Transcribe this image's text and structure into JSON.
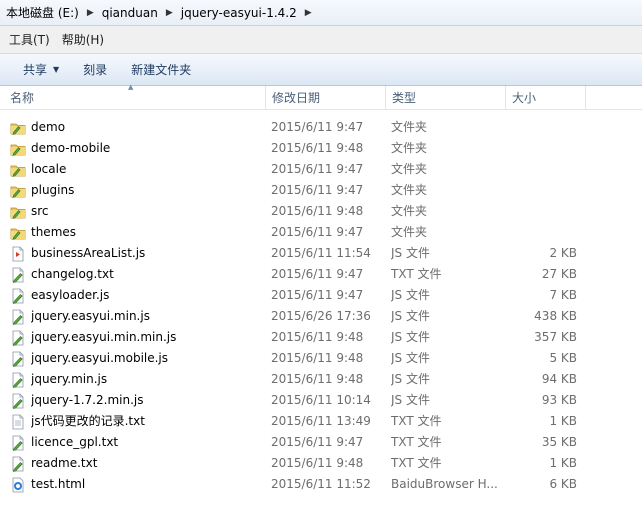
{
  "breadcrumb": [
    "本地磁盘 (E:)",
    "qianduan",
    "jquery-easyui-1.4.2"
  ],
  "menu": [
    "工具(T)",
    "帮助(H)"
  ],
  "toolbar": {
    "share": "共享",
    "burn": "刻录",
    "new_folder": "新建文件夹"
  },
  "columns": {
    "name": "名称",
    "date": "修改日期",
    "type": "类型",
    "size": "大小"
  },
  "files": [
    {
      "icon": "folder-icon",
      "name": "demo",
      "date": "2015/6/11 9:47",
      "type": "文件夹",
      "size": ""
    },
    {
      "icon": "folder-icon",
      "name": "demo-mobile",
      "date": "2015/6/11 9:48",
      "type": "文件夹",
      "size": ""
    },
    {
      "icon": "folder-icon",
      "name": "locale",
      "date": "2015/6/11 9:47",
      "type": "文件夹",
      "size": ""
    },
    {
      "icon": "folder-icon",
      "name": "plugins",
      "date": "2015/6/11 9:47",
      "type": "文件夹",
      "size": ""
    },
    {
      "icon": "folder-icon",
      "name": "src",
      "date": "2015/6/11 9:48",
      "type": "文件夹",
      "size": ""
    },
    {
      "icon": "folder-icon",
      "name": "themes",
      "date": "2015/6/11 9:47",
      "type": "文件夹",
      "size": ""
    },
    {
      "icon": "js-file-red-icon",
      "name": "businessAreaList.js",
      "date": "2015/6/11 11:54",
      "type": "JS 文件",
      "size": "2 KB"
    },
    {
      "icon": "edited-file-icon",
      "name": "changelog.txt",
      "date": "2015/6/11 9:47",
      "type": "TXT 文件",
      "size": "27 KB"
    },
    {
      "icon": "edited-file-icon",
      "name": "easyloader.js",
      "date": "2015/6/11 9:47",
      "type": "JS 文件",
      "size": "7 KB"
    },
    {
      "icon": "edited-file-icon",
      "name": "jquery.easyui.min.js",
      "date": "2015/6/26 17:36",
      "type": "JS 文件",
      "size": "438 KB"
    },
    {
      "icon": "edited-file-icon",
      "name": "jquery.easyui.min.min.js",
      "date": "2015/6/11 9:48",
      "type": "JS 文件",
      "size": "357 KB"
    },
    {
      "icon": "edited-file-icon",
      "name": "jquery.easyui.mobile.js",
      "date": "2015/6/11 9:48",
      "type": "JS 文件",
      "size": "5 KB"
    },
    {
      "icon": "edited-file-icon",
      "name": "jquery.min.js",
      "date": "2015/6/11 9:48",
      "type": "JS 文件",
      "size": "94 KB"
    },
    {
      "icon": "edited-file-icon",
      "name": "jquery-1.7.2.min.js",
      "date": "2015/6/11 10:14",
      "type": "JS 文件",
      "size": "93 KB"
    },
    {
      "icon": "text-file-icon",
      "name": "js代码更改的记录.txt",
      "date": "2015/6/11 13:49",
      "type": "TXT 文件",
      "size": "1 KB"
    },
    {
      "icon": "edited-file-icon",
      "name": "licence_gpl.txt",
      "date": "2015/6/11 9:47",
      "type": "TXT 文件",
      "size": "35 KB"
    },
    {
      "icon": "edited-file-icon",
      "name": "readme.txt",
      "date": "2015/6/11 9:48",
      "type": "TXT 文件",
      "size": "1 KB"
    },
    {
      "icon": "html-file-icon",
      "name": "test.html",
      "date": "2015/6/11 11:52",
      "type": "BaiduBrowser H...",
      "size": "6 KB"
    }
  ]
}
